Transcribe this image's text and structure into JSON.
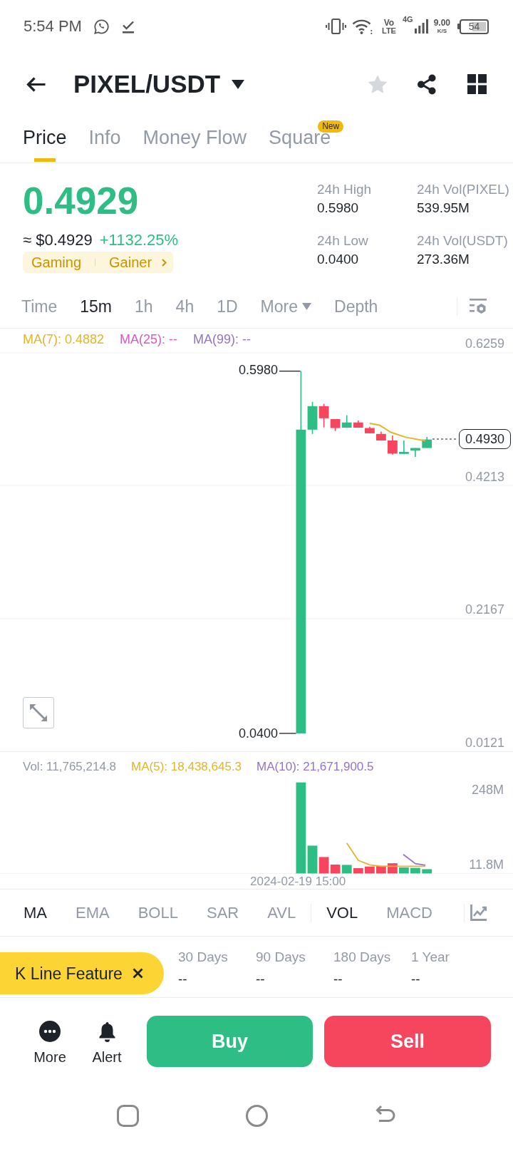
{
  "status_bar": {
    "time": "5:54 PM",
    "volte_top": "Vo",
    "volte_bottom": "LTE",
    "network": "4G",
    "speed": "9.00",
    "speed_unit": "K/S",
    "battery": "54"
  },
  "header": {
    "title": "PIXEL/USDT",
    "favorite": false
  },
  "tabs": [
    {
      "label": "Price",
      "selected": true
    },
    {
      "label": "Info",
      "selected": false
    },
    {
      "label": "Money Flow",
      "selected": false
    },
    {
      "label": "Square",
      "selected": false,
      "badge": "New"
    }
  ],
  "price": {
    "last": "0.4929",
    "fiat": "≈ $0.4929",
    "change": "+1132.25%",
    "tags": [
      "Gaming",
      "Gainer"
    ]
  },
  "stats": [
    {
      "label": "24h High",
      "value": "0.5980"
    },
    {
      "label": "24h Vol(PIXEL)",
      "value": "539.95M"
    },
    {
      "label": "24h Low",
      "value": "0.0400"
    },
    {
      "label": "24h Vol(USDT)",
      "value": "273.36M"
    }
  ],
  "intervals": [
    {
      "label": "Time",
      "kind": "option",
      "selected": false
    },
    {
      "label": "15m",
      "kind": "option",
      "selected": true
    },
    {
      "label": "1h",
      "kind": "option",
      "selected": false
    },
    {
      "label": "4h",
      "kind": "option",
      "selected": false
    },
    {
      "label": "1D",
      "kind": "option",
      "selected": false
    },
    {
      "label": "More",
      "kind": "dropdown",
      "selected": false
    },
    {
      "label": "Depth",
      "kind": "option",
      "selected": false
    }
  ],
  "chart": {
    "ma_legend": [
      {
        "label": "MA(7): 0.4882",
        "color": "#e2b52c"
      },
      {
        "label": "MA(25): --",
        "color": "#d35bc4"
      },
      {
        "label": "MA(99): --",
        "color": "#9572c8"
      }
    ],
    "price_axis": [
      "0.6259",
      "0.4213",
      "0.2167",
      "0.0121"
    ],
    "high_marker": "0.5980",
    "low_marker": "0.0400",
    "last_price_tag": "0.4930"
  },
  "volume": {
    "legend": [
      {
        "label": "Vol: 11,765,214.8",
        "color": "#929aa5"
      },
      {
        "label": "MA(5): 18,438,645.3",
        "color": "#e2b52c"
      },
      {
        "label": "MA(10): 21,671,900.5",
        "color": "#9572c8"
      }
    ],
    "axis": [
      "248M",
      "11.8M"
    ],
    "time_label": "2024-02-19 15:00"
  },
  "indicators": {
    "main": [
      {
        "label": "MA",
        "selected": true
      },
      {
        "label": "EMA",
        "selected": false
      },
      {
        "label": "BOLL",
        "selected": false
      },
      {
        "label": "SAR",
        "selected": false
      },
      {
        "label": "AVL",
        "selected": false
      }
    ],
    "sub": [
      {
        "label": "VOL",
        "selected": true
      },
      {
        "label": "MACD",
        "selected": false
      }
    ]
  },
  "period_returns": [
    {
      "label": "30 Days",
      "value": "--"
    },
    {
      "label": "90 Days",
      "value": "--"
    },
    {
      "label": "180 Days",
      "value": "--"
    },
    {
      "label": "1 Year",
      "value": "--"
    }
  ],
  "feature_banner": {
    "label": "K Line Feature"
  },
  "actions": {
    "shortcuts": [
      {
        "label": "More",
        "kind": "more"
      },
      {
        "label": "Alert",
        "kind": "alert"
      }
    ],
    "buy": "Buy",
    "sell": "Sell"
  }
}
